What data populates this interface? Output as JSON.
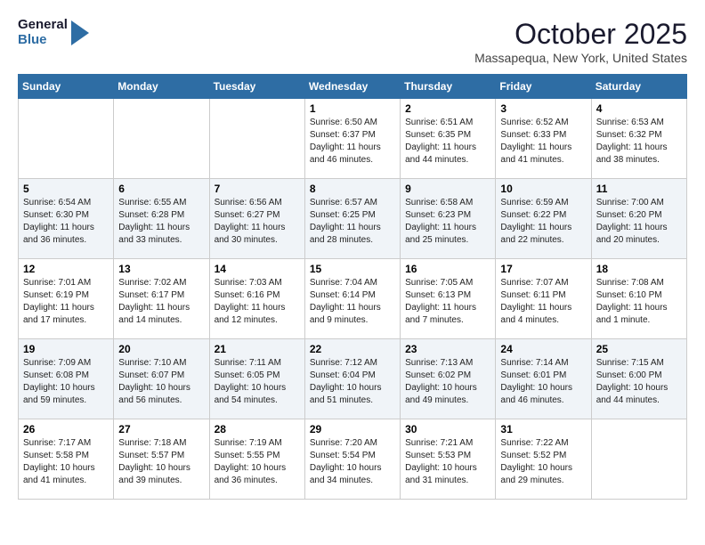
{
  "logo": {
    "line1": "General",
    "line2": "Blue"
  },
  "title": "October 2025",
  "location": "Massapequa, New York, United States",
  "weekdays": [
    "Sunday",
    "Monday",
    "Tuesday",
    "Wednesday",
    "Thursday",
    "Friday",
    "Saturday"
  ],
  "weeks": [
    [
      {
        "day": "",
        "info": ""
      },
      {
        "day": "",
        "info": ""
      },
      {
        "day": "",
        "info": ""
      },
      {
        "day": "1",
        "info": "Sunrise: 6:50 AM\nSunset: 6:37 PM\nDaylight: 11 hours\nand 46 minutes."
      },
      {
        "day": "2",
        "info": "Sunrise: 6:51 AM\nSunset: 6:35 PM\nDaylight: 11 hours\nand 44 minutes."
      },
      {
        "day": "3",
        "info": "Sunrise: 6:52 AM\nSunset: 6:33 PM\nDaylight: 11 hours\nand 41 minutes."
      },
      {
        "day": "4",
        "info": "Sunrise: 6:53 AM\nSunset: 6:32 PM\nDaylight: 11 hours\nand 38 minutes."
      }
    ],
    [
      {
        "day": "5",
        "info": "Sunrise: 6:54 AM\nSunset: 6:30 PM\nDaylight: 11 hours\nand 36 minutes."
      },
      {
        "day": "6",
        "info": "Sunrise: 6:55 AM\nSunset: 6:28 PM\nDaylight: 11 hours\nand 33 minutes."
      },
      {
        "day": "7",
        "info": "Sunrise: 6:56 AM\nSunset: 6:27 PM\nDaylight: 11 hours\nand 30 minutes."
      },
      {
        "day": "8",
        "info": "Sunrise: 6:57 AM\nSunset: 6:25 PM\nDaylight: 11 hours\nand 28 minutes."
      },
      {
        "day": "9",
        "info": "Sunrise: 6:58 AM\nSunset: 6:23 PM\nDaylight: 11 hours\nand 25 minutes."
      },
      {
        "day": "10",
        "info": "Sunrise: 6:59 AM\nSunset: 6:22 PM\nDaylight: 11 hours\nand 22 minutes."
      },
      {
        "day": "11",
        "info": "Sunrise: 7:00 AM\nSunset: 6:20 PM\nDaylight: 11 hours\nand 20 minutes."
      }
    ],
    [
      {
        "day": "12",
        "info": "Sunrise: 7:01 AM\nSunset: 6:19 PM\nDaylight: 11 hours\nand 17 minutes."
      },
      {
        "day": "13",
        "info": "Sunrise: 7:02 AM\nSunset: 6:17 PM\nDaylight: 11 hours\nand 14 minutes."
      },
      {
        "day": "14",
        "info": "Sunrise: 7:03 AM\nSunset: 6:16 PM\nDaylight: 11 hours\nand 12 minutes."
      },
      {
        "day": "15",
        "info": "Sunrise: 7:04 AM\nSunset: 6:14 PM\nDaylight: 11 hours\nand 9 minutes."
      },
      {
        "day": "16",
        "info": "Sunrise: 7:05 AM\nSunset: 6:13 PM\nDaylight: 11 hours\nand 7 minutes."
      },
      {
        "day": "17",
        "info": "Sunrise: 7:07 AM\nSunset: 6:11 PM\nDaylight: 11 hours\nand 4 minutes."
      },
      {
        "day": "18",
        "info": "Sunrise: 7:08 AM\nSunset: 6:10 PM\nDaylight: 11 hours\nand 1 minute."
      }
    ],
    [
      {
        "day": "19",
        "info": "Sunrise: 7:09 AM\nSunset: 6:08 PM\nDaylight: 10 hours\nand 59 minutes."
      },
      {
        "day": "20",
        "info": "Sunrise: 7:10 AM\nSunset: 6:07 PM\nDaylight: 10 hours\nand 56 minutes."
      },
      {
        "day": "21",
        "info": "Sunrise: 7:11 AM\nSunset: 6:05 PM\nDaylight: 10 hours\nand 54 minutes."
      },
      {
        "day": "22",
        "info": "Sunrise: 7:12 AM\nSunset: 6:04 PM\nDaylight: 10 hours\nand 51 minutes."
      },
      {
        "day": "23",
        "info": "Sunrise: 7:13 AM\nSunset: 6:02 PM\nDaylight: 10 hours\nand 49 minutes."
      },
      {
        "day": "24",
        "info": "Sunrise: 7:14 AM\nSunset: 6:01 PM\nDaylight: 10 hours\nand 46 minutes."
      },
      {
        "day": "25",
        "info": "Sunrise: 7:15 AM\nSunset: 6:00 PM\nDaylight: 10 hours\nand 44 minutes."
      }
    ],
    [
      {
        "day": "26",
        "info": "Sunrise: 7:17 AM\nSunset: 5:58 PM\nDaylight: 10 hours\nand 41 minutes."
      },
      {
        "day": "27",
        "info": "Sunrise: 7:18 AM\nSunset: 5:57 PM\nDaylight: 10 hours\nand 39 minutes."
      },
      {
        "day": "28",
        "info": "Sunrise: 7:19 AM\nSunset: 5:55 PM\nDaylight: 10 hours\nand 36 minutes."
      },
      {
        "day": "29",
        "info": "Sunrise: 7:20 AM\nSunset: 5:54 PM\nDaylight: 10 hours\nand 34 minutes."
      },
      {
        "day": "30",
        "info": "Sunrise: 7:21 AM\nSunset: 5:53 PM\nDaylight: 10 hours\nand 31 minutes."
      },
      {
        "day": "31",
        "info": "Sunrise: 7:22 AM\nSunset: 5:52 PM\nDaylight: 10 hours\nand 29 minutes."
      },
      {
        "day": "",
        "info": ""
      }
    ]
  ]
}
